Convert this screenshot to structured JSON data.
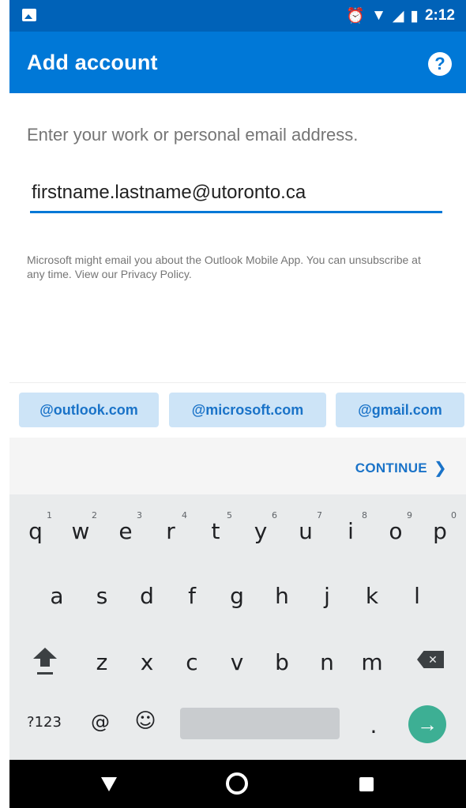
{
  "status_bar": {
    "time": "2:12",
    "icons": [
      "image-notification-icon",
      "alarm-icon",
      "wifi-icon",
      "signal-icon",
      "battery-icon"
    ]
  },
  "app_bar": {
    "title": "Add account",
    "help_symbol": "?"
  },
  "form": {
    "prompt": "Enter your work or personal email address.",
    "email_value": "firstname.lastname@utoronto.ca",
    "disclaimer": "Microsoft might email you about the Outlook Mobile App. You can unsubscribe at any time. View our Privacy Policy."
  },
  "suggestions": [
    "@outlook.com",
    "@microsoft.com",
    "@gmail.com"
  ],
  "continue_label": "CONTINUE",
  "keyboard": {
    "row1": [
      {
        "key": "q",
        "hint": "1"
      },
      {
        "key": "w",
        "hint": "2"
      },
      {
        "key": "e",
        "hint": "3"
      },
      {
        "key": "r",
        "hint": "4"
      },
      {
        "key": "t",
        "hint": "5"
      },
      {
        "key": "y",
        "hint": "6"
      },
      {
        "key": "u",
        "hint": "7"
      },
      {
        "key": "i",
        "hint": "8"
      },
      {
        "key": "o",
        "hint": "9"
      },
      {
        "key": "p",
        "hint": "0"
      }
    ],
    "row2": [
      "a",
      "s",
      "d",
      "f",
      "g",
      "h",
      "j",
      "k",
      "l"
    ],
    "row3": [
      "z",
      "x",
      "c",
      "v",
      "b",
      "n",
      "m"
    ],
    "symbols_label": "?123",
    "at_label": "@",
    "emoji_label": "☺",
    "period_label": ".",
    "enter_symbol": "→",
    "backspace_symbol": "✕"
  },
  "colors": {
    "status_bar": "#0062b8",
    "app_bar": "#0078d7",
    "accent": "#1a73c8",
    "chip_bg": "#cde4f7",
    "enter_key": "#3daf94"
  }
}
